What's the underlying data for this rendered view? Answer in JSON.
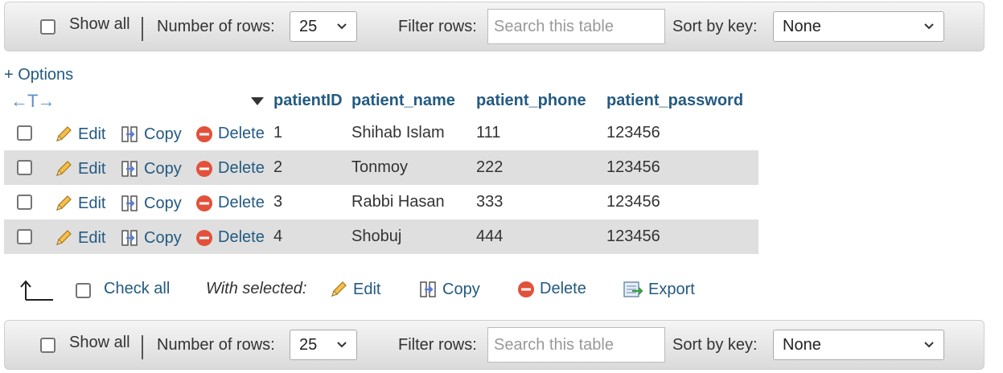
{
  "top_nav": {
    "show_all_label": "Show all",
    "rows_label": "Number of rows:",
    "rows_value": "25",
    "filter_label": "Filter rows:",
    "filter_placeholder": "Search this table",
    "sort_label": "Sort by key:",
    "sort_value": "None"
  },
  "options_link": "+ Options",
  "table": {
    "columns": [
      "patientID",
      "patient_name",
      "patient_phone",
      "patient_password"
    ],
    "action_labels": {
      "edit": "Edit",
      "copy": "Copy",
      "delete": "Delete"
    },
    "rows": [
      {
        "patientID": "1",
        "patient_name": "Shihab Islam",
        "patient_phone": "111",
        "patient_password": "123456"
      },
      {
        "patientID": "2",
        "patient_name": "Tonmoy",
        "patient_phone": "222",
        "patient_password": "123456"
      },
      {
        "patientID": "3",
        "patient_name": "Rabbi Hasan",
        "patient_phone": "333",
        "patient_password": "123456"
      },
      {
        "patientID": "4",
        "patient_name": "Shobuj",
        "patient_phone": "444",
        "patient_password": "123456"
      }
    ]
  },
  "bulk_actions": {
    "check_all_label": "Check all",
    "with_selected_label": "With selected:",
    "edit_label": "Edit",
    "copy_label": "Copy",
    "delete_label": "Delete",
    "export_label": "Export"
  },
  "bottom_nav": {
    "show_all_label": "Show all",
    "rows_label": "Number of rows:",
    "rows_value": "25",
    "filter_label": "Filter rows:",
    "filter_placeholder": "Search this table",
    "sort_label": "Sort by key:",
    "sort_value": "None"
  },
  "colors": {
    "link": "#235a81",
    "row_alt": "#dfdfdf",
    "delete_icon": "#e2513b"
  }
}
